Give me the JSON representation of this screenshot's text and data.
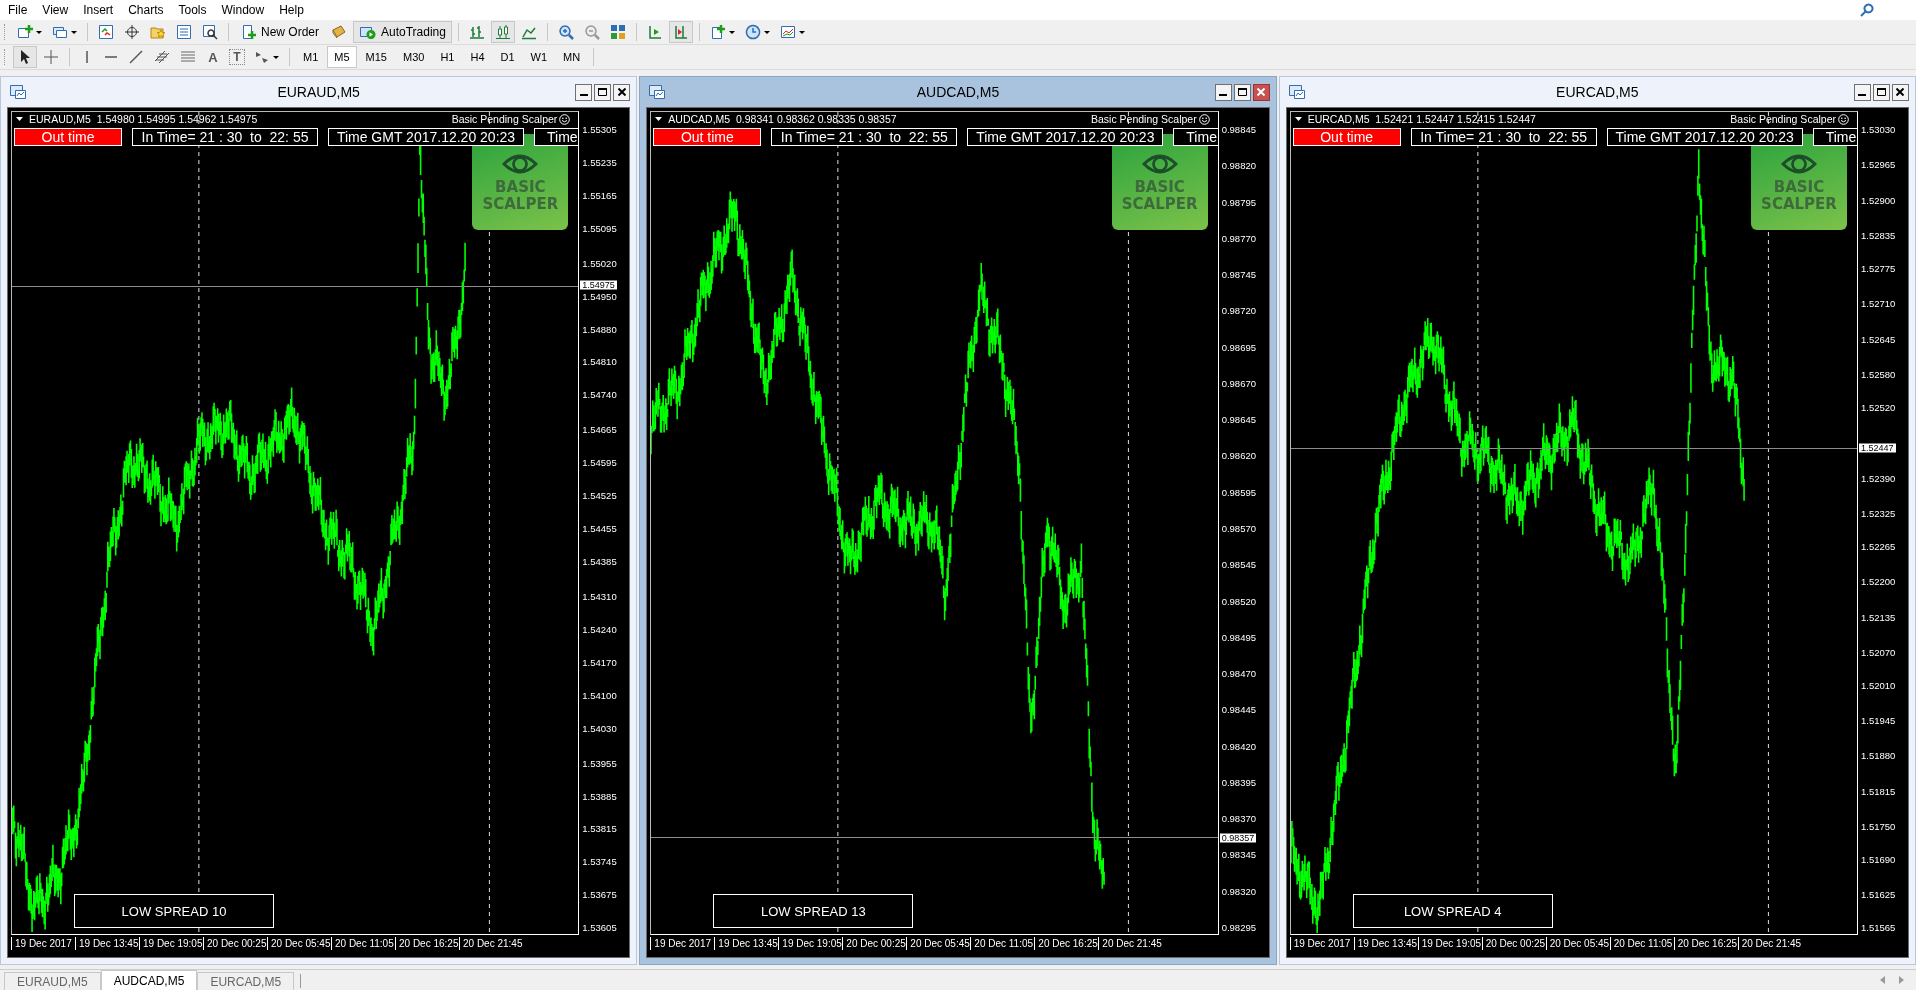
{
  "menu": [
    "File",
    "View",
    "Insert",
    "Charts",
    "Tools",
    "Window",
    "Help"
  ],
  "toolbar": {
    "new_order": "New Order",
    "auto_trading": "AutoTrading"
  },
  "drawing_tools": {
    "text_tool": "A",
    "label_tool": "T"
  },
  "timeframes": [
    {
      "label": "M1",
      "selected": false
    },
    {
      "label": "M5",
      "selected": true
    },
    {
      "label": "M15",
      "selected": false
    },
    {
      "label": "M30",
      "selected": false
    },
    {
      "label": "H1",
      "selected": false
    },
    {
      "label": "H4",
      "selected": false
    },
    {
      "label": "D1",
      "selected": false
    },
    {
      "label": "W1",
      "selected": false
    },
    {
      "label": "MN",
      "selected": false
    }
  ],
  "windows": [
    {
      "title": "EURAUD,M5",
      "active": false,
      "quote": "EURAUD,M5  1.54980 1.54995 1.54962 1.54975",
      "indicator": "Basic Pending Scalper",
      "out_time": "Out time",
      "in_time": "In Time= 21 : 30  to  22: 55",
      "gmt_time": "Time GMT 2017.12.20 20:23",
      "time_cut": "Time",
      "logo": "BASIC SCALPER",
      "spread": "LOW SPREAD 10",
      "price_ticks": [
        "1.55305",
        "1.55235",
        "1.55165",
        "1.55095",
        "1.55020",
        "1.54950",
        "1.54880",
        "1.54810",
        "1.54740",
        "1.54665",
        "1.54595",
        "1.54525",
        "1.54455",
        "1.54385",
        "1.54310",
        "1.54240",
        "1.54170",
        "1.54100",
        "1.54030",
        "1.53955",
        "1.53885",
        "1.53815",
        "1.53745",
        "1.53675",
        "1.53605"
      ],
      "current_price": "1.54975",
      "time_ticks": [
        "19 Dec 2017",
        "19 Dec 13:45",
        "19 Dec 19:05",
        "20 Dec 00:25",
        "20 Dec 05:45",
        "20 Dec 11:05",
        "20 Dec 16:25",
        "20 Dec 21:45"
      ]
    },
    {
      "title": "AUDCAD,M5",
      "active": true,
      "quote": "AUDCAD,M5  0.98341 0.98362 0.98335 0.98357",
      "indicator": "Basic Pending Scalper",
      "out_time": "Out time",
      "in_time": "In Time= 21 : 30  to  22: 55",
      "gmt_time": "Time GMT 2017.12.20 20:23",
      "time_cut": "Time",
      "logo": "BASIC SCALPER",
      "spread": "LOW SPREAD 13",
      "price_ticks": [
        "0.98845",
        "0.98820",
        "0.98795",
        "0.98770",
        "0.98745",
        "0.98720",
        "0.98695",
        "0.98670",
        "0.98645",
        "0.98620",
        "0.98595",
        "0.98570",
        "0.98545",
        "0.98520",
        "0.98495",
        "0.98470",
        "0.98445",
        "0.98420",
        "0.98395",
        "0.98370",
        "0.98345",
        "0.98320",
        "0.98295"
      ],
      "current_price": "0.98357",
      "time_ticks": [
        "19 Dec 2017",
        "19 Dec 13:45",
        "19 Dec 19:05",
        "20 Dec 00:25",
        "20 Dec 05:45",
        "20 Dec 11:05",
        "20 Dec 16:25",
        "20 Dec 21:45"
      ]
    },
    {
      "title": "EURCAD,M5",
      "active": false,
      "quote": "EURCAD,M5  1.52421 1.52447 1.52415 1.52447",
      "indicator": "Basic Pending Scalper",
      "out_time": "Out time",
      "in_time": "In Time= 21 : 30  to  22: 55",
      "gmt_time": "Time GMT 2017.12.20 20:23",
      "time_cut": "Time",
      "logo": "BASIC SCALPER",
      "spread": "LOW SPREAD 4",
      "price_ticks": [
        "1.53030",
        "1.52965",
        "1.52900",
        "1.52835",
        "1.52775",
        "1.52710",
        "1.52645",
        "1.52580",
        "1.52520",
        "1.52390",
        "1.52325",
        "1.52265",
        "1.52200",
        "1.52135",
        "1.52070",
        "1.52010",
        "1.51945",
        "1.51880",
        "1.51815",
        "1.51750",
        "1.51690",
        "1.51625",
        "1.51565"
      ],
      "current_price": "1.52447",
      "time_ticks": [
        "19 Dec 2017",
        "19 Dec 13:45",
        "19 Dec 19:05",
        "20 Dec 00:25",
        "20 Dec 05:45",
        "20 Dec 11:05",
        "20 Dec 16:25",
        "20 Dec 21:45"
      ]
    }
  ],
  "tabs": [
    {
      "label": "EURAUD,M5",
      "selected": false
    },
    {
      "label": "AUDCAD,M5",
      "selected": true
    },
    {
      "label": "EURCAD,M5",
      "selected": false
    }
  ]
}
